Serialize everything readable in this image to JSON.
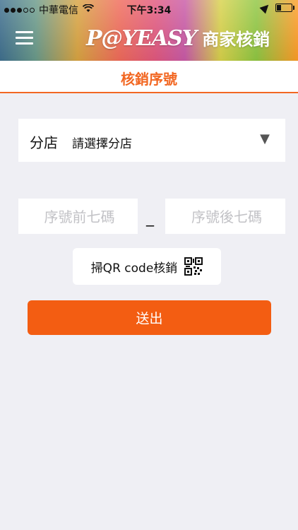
{
  "statusbar": {
    "carrier": "中華電信",
    "time": "下午3:34",
    "signal_filled": 3,
    "signal_total": 5,
    "battery_level": 0.3
  },
  "header": {
    "logo_text": "P@YEASY",
    "title": "商家核銷",
    "menu_icon": "hamburger-menu-icon"
  },
  "subheader": {
    "title": "核銷序號",
    "accent_color": "#f26722"
  },
  "branch": {
    "label": "分店",
    "value": "請選擇分店",
    "icon": "chevron-down-icon"
  },
  "serial": {
    "first_placeholder": "序號前七碼",
    "second_placeholder": "序號後七碼",
    "separator": "_"
  },
  "qr": {
    "label": "掃QR code核銷",
    "icon": "qr-code-icon"
  },
  "submit": {
    "label": "送出",
    "color": "#f35d12"
  }
}
